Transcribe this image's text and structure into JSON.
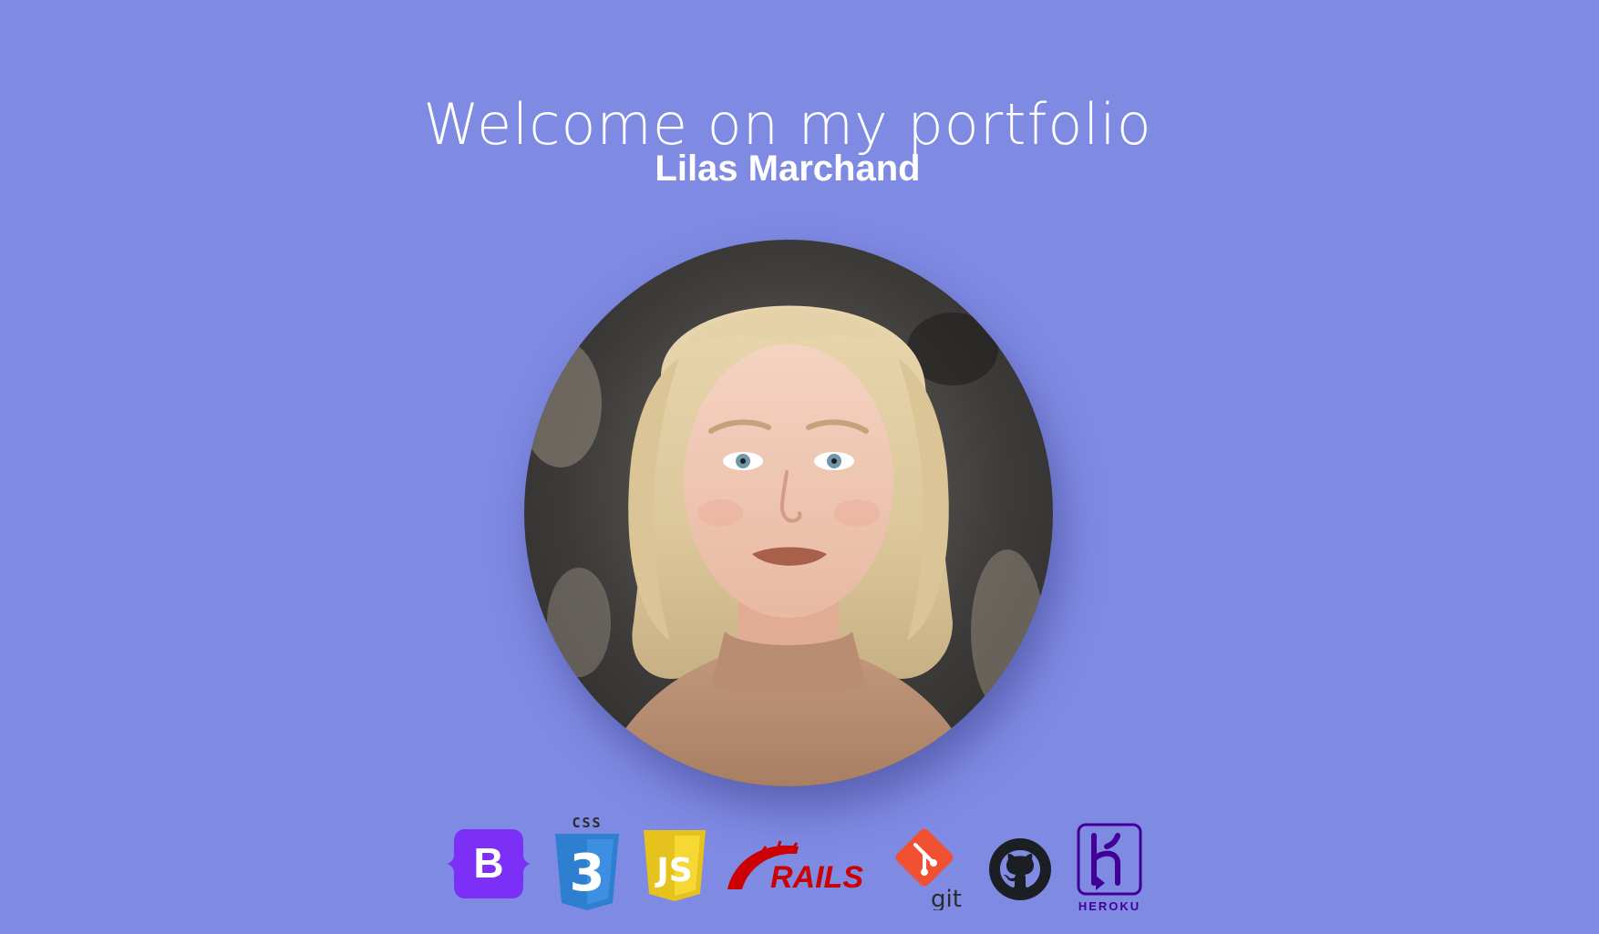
{
  "header": {
    "title": "Welcome on my portfolio",
    "name": "Lilas Marchand"
  },
  "avatar": {
    "alt": "Portrait photo",
    "background_color": "#4f4f4f"
  },
  "tech_stack": {
    "items": [
      {
        "name": "bootstrap-icon",
        "label": "B"
      },
      {
        "name": "css3-icon",
        "label": "CSS",
        "numeral": "3"
      },
      {
        "name": "javascript-icon",
        "label": "JS"
      },
      {
        "name": "rails-icon",
        "label": "RAILS"
      },
      {
        "name": "git-icon",
        "label": "git"
      },
      {
        "name": "github-icon",
        "label": ""
      },
      {
        "name": "heroku-icon",
        "label": "HEROKU"
      }
    ]
  },
  "colors": {
    "background": "#7f8ae3",
    "bootstrap": "#7b2ff7",
    "css": "#2f7fd1",
    "js": "#f5d834",
    "rails": "#cc0000",
    "git": "#f05133",
    "github": "#1b1f23",
    "heroku": "#430098"
  }
}
